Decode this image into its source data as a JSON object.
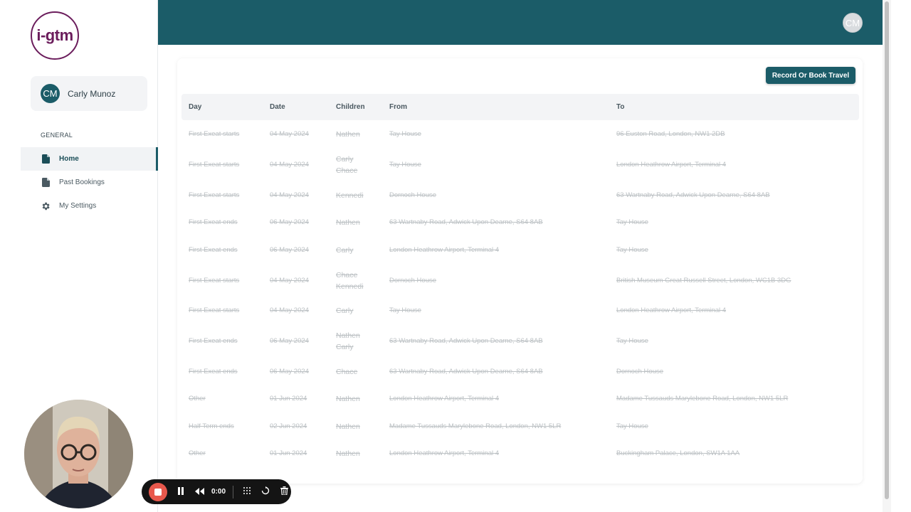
{
  "app": {
    "logo_text": "i-gtm",
    "brand_color": "#6b1d5c",
    "accent_color": "#1b5c68"
  },
  "user": {
    "initials": "CM",
    "name": "Carly Munoz"
  },
  "topbar": {
    "avatar_initials": "CM"
  },
  "sidebar": {
    "section_label": "GENERAL",
    "items": [
      {
        "label": "Home",
        "icon": "document-icon",
        "active": true
      },
      {
        "label": "Past Bookings",
        "icon": "document-icon",
        "active": false
      },
      {
        "label": "My Settings",
        "icon": "gear-icon",
        "active": false
      }
    ]
  },
  "main": {
    "book_button_label": "Record Or Book Travel",
    "columns": [
      "Day",
      "Date",
      "Children",
      "From",
      "To"
    ],
    "rows": [
      {
        "day": "First Exeat starts",
        "date": "04 May 2024",
        "children": [
          "Nathen"
        ],
        "from": "Tay House",
        "to": "96 Euston Road, London, NW1 2DB"
      },
      {
        "day": "First Exeat starts",
        "date": "04 May 2024",
        "children": [
          "Carly",
          "Chace"
        ],
        "from": "Tay House",
        "to": "London Heathrow Airport, Terminal 4"
      },
      {
        "day": "First Exeat starts",
        "date": "04 May 2024",
        "children": [
          "Kennedi"
        ],
        "from": "Dornoch House",
        "to": "63 Wartnaby Road, Adwick Upon Dearne, S64 8AB"
      },
      {
        "day": "First Exeat ends",
        "date": "06 May 2024",
        "children": [
          "Nathen"
        ],
        "from": "63 Wartnaby Road, Adwick Upon Dearne, S64 8AB",
        "to": "Tay House"
      },
      {
        "day": "First Exeat ends",
        "date": "06 May 2024",
        "children": [
          "Carly"
        ],
        "from": "London Heathrow Airport, Terminal 4",
        "to": "Tay House"
      },
      {
        "day": "First Exeat starts",
        "date": "04 May 2024",
        "children": [
          "Chace",
          "Kennedi"
        ],
        "from": "Dornoch House",
        "to": "British Museum Great Russell Street, London, WC1B 3DG"
      },
      {
        "day": "First Exeat starts",
        "date": "04 May 2024",
        "children": [
          "Carly"
        ],
        "from": "Tay House",
        "to": "London Heathrow Airport, Terminal 4"
      },
      {
        "day": "First Exeat ends",
        "date": "06 May 2024",
        "children": [
          "Nathen",
          "Carly"
        ],
        "from": "63 Wartnaby Road, Adwick Upon Dearne, S64 8AB",
        "to": "Tay House"
      },
      {
        "day": "First Exeat ends",
        "date": "06 May 2024",
        "children": [
          "Chace"
        ],
        "from": "63 Wartnaby Road, Adwick Upon Dearne, S64 8AB",
        "to": "Dornoch House"
      },
      {
        "day": "Other",
        "date": "01 Jun 2024",
        "children": [
          "Nathen"
        ],
        "from": "London Heathrow Airport, Terminal 4",
        "to": "Madame Tussauds Marylebone Road, London, NW1 5LR"
      },
      {
        "day": "Half Term ends",
        "date": "02 Jun 2024",
        "children": [
          "Nathen"
        ],
        "from": "Madame Tussauds Marylebone Road, London, NW1 5LR",
        "to": "Tay House"
      },
      {
        "day": "Other",
        "date": "01 Jun 2024",
        "children": [
          "Nathen"
        ],
        "from": "London Heathrow Airport, Terminal 4",
        "to": "Buckingham Palace, London, SW1A 1AA"
      }
    ]
  },
  "recorder": {
    "time": "0:00"
  }
}
